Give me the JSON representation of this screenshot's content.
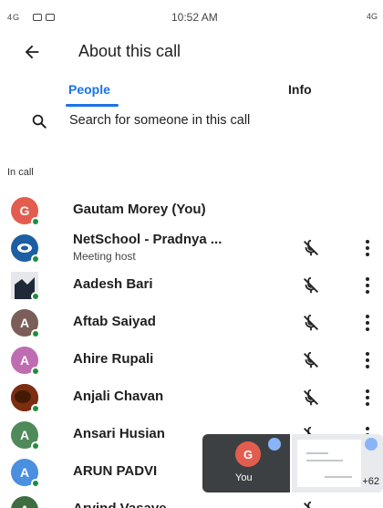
{
  "status_bar": {
    "left_signal": "4G",
    "time": "10:52 AM",
    "right_signal": "4G"
  },
  "header": {
    "title": "About this call"
  },
  "tabs": [
    {
      "label": "People",
      "active": true
    },
    {
      "label": "Info",
      "active": false
    }
  ],
  "search": {
    "placeholder": "Search for someone in this call"
  },
  "section_label": "In call",
  "participants": [
    {
      "name": "Gautam Morey (You)",
      "initial": "G",
      "avatar_color": "#e35d4f",
      "subtitle": "",
      "muted_icon": false
    },
    {
      "name": "NetSchool - Pradnya ...",
      "initial": "",
      "avatar_color": "#1c5fa3",
      "subtitle": "Meeting host",
      "muted_icon": true
    },
    {
      "name": "Aadesh Bari",
      "initial": "",
      "avatar_color": "#334155",
      "subtitle": "",
      "muted_icon": true
    },
    {
      "name": "Aftab Saiyad",
      "initial": "A",
      "avatar_color": "#7b5e57",
      "subtitle": "",
      "muted_icon": true
    },
    {
      "name": "Ahire Rupali",
      "initial": "A",
      "avatar_color": "#c06cb0",
      "subtitle": "",
      "muted_icon": true
    },
    {
      "name": "Anjali Chavan",
      "initial": "",
      "avatar_color": "#6b2f1e",
      "subtitle": "",
      "muted_icon": true
    },
    {
      "name": "Ansari Husian",
      "initial": "A",
      "avatar_color": "#4e8a5a",
      "subtitle": "",
      "muted_icon": true
    },
    {
      "name": "ARUN PADVI",
      "initial": "A",
      "avatar_color": "#4a8fe0",
      "subtitle": "",
      "muted_icon": true
    },
    {
      "name": "Arvind Vasave",
      "initial": "A",
      "avatar_color": "#3c6e3f",
      "subtitle": "",
      "muted_icon": true
    }
  ],
  "pip": {
    "self_initial": "G",
    "self_label": "You",
    "extra_count": "+62"
  }
}
